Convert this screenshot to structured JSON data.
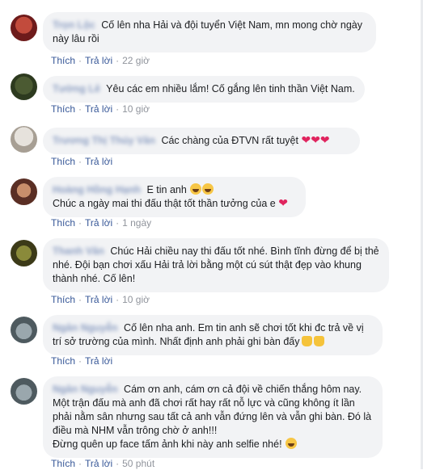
{
  "action_labels": {
    "like": "Thích",
    "reply": "Trả lời"
  },
  "comments": [
    {
      "name": "Trọn Lộc",
      "text": "Cố lên nha Hải và đội tuyển Việt Nam, mn mong chờ ngày này lâu rồi",
      "time": "22 giờ",
      "avatar_color": "#8c2d2d"
    },
    {
      "name": "Tường Lê",
      "text": "Yêu các em nhiều lắm! Cố gắng lên tinh thần Việt Nam.",
      "time": "10 giờ",
      "avatar_color": "#5a6b3c"
    },
    {
      "name": "Trương Thị Thúy Vân",
      "text": "Các chàng của ĐTVN rất tuyệt",
      "emoji": "❤❤❤",
      "time": "",
      "avatar_color": "#c9c2b8"
    },
    {
      "name": "Hoàng Hồng Hạnh",
      "text": "E tin anh",
      "text2": "Chúc a ngày mai thi đấu thật tốt thần tưởng của e",
      "emoji2": "❤",
      "time": "1 ngày",
      "avatar_color": "#7a4a3a"
    },
    {
      "name": "Thanh Vân",
      "text": "Chúc Hải chiều nay thi đấu tốt nhé. Bình tĩnh đừng để bị thẻ nhé. Đội bạn chơi xấu Hải trả lời bằng một cú sút thật đẹp vào khung thành nhé. Cố lên!",
      "time": "10 giờ",
      "avatar_color": "#6d6a2f"
    },
    {
      "name": "Ngân Nguyễn",
      "text": "Cố lên nha anh. Em tin anh sẽ chơi tốt khi đc trả về vị trí sở trường của mình. Nhất định anh phải ghi bàn đấy",
      "time": "",
      "avatar_color": "#6f7f86"
    },
    {
      "name": "Ngân Nguyễn",
      "text": "Cám ơn anh, cám ơn cả đội về chiến thắng hôm nay. Một trận đấu mà anh đã chơi rất hay rất nỗ lực và cũng không ít lần phải nằm sân nhưng sau tất cả anh vẫn đứng lên và vẫn ghi bàn. Đó là điều mà NHM vẫn trông chờ ở anh!!!",
      "text2": "Đừng quên up face tấm ảnh khi này anh selfie nhé!",
      "time": "50 phút",
      "avatar_color": "#6f7f86"
    }
  ]
}
